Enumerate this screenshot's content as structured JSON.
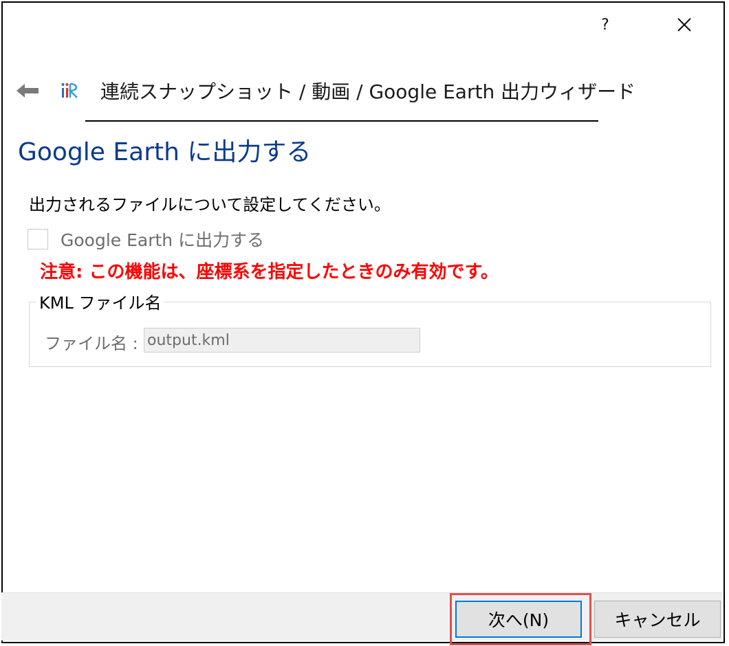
{
  "titlebar": {
    "help_label": "?",
    "help_icon": "question-mark-icon",
    "close_icon": "close-x-icon"
  },
  "header": {
    "back_icon": "arrow-left-icon",
    "logo_icon": "iric-logo-icon",
    "wizard_title": "連続スナップショット / 動画 / Google Earth 出力ウィザード"
  },
  "page": {
    "title": "Google Earth に出力する",
    "instructions": "出力されるファイルについて設定してください。",
    "checkbox": {
      "label": "Google Earth に出力する",
      "checked": false,
      "enabled": false
    },
    "warning": "注意: この機能は、座標系を指定したときのみ有効です。",
    "group": {
      "legend": "KML ファイル名",
      "field_label": "ファイル名 :",
      "field_value": "output.kml"
    }
  },
  "footer": {
    "next_label": "次へ(N)",
    "cancel_label": "キャンセル"
  },
  "colors": {
    "page_title": "#0a3a8c",
    "warning": "#ff0000",
    "disabled_text": "#6d6d6d",
    "focus_border": "#0078d7",
    "highlight": "#e05050",
    "footer_bg": "#f0f0f0"
  }
}
